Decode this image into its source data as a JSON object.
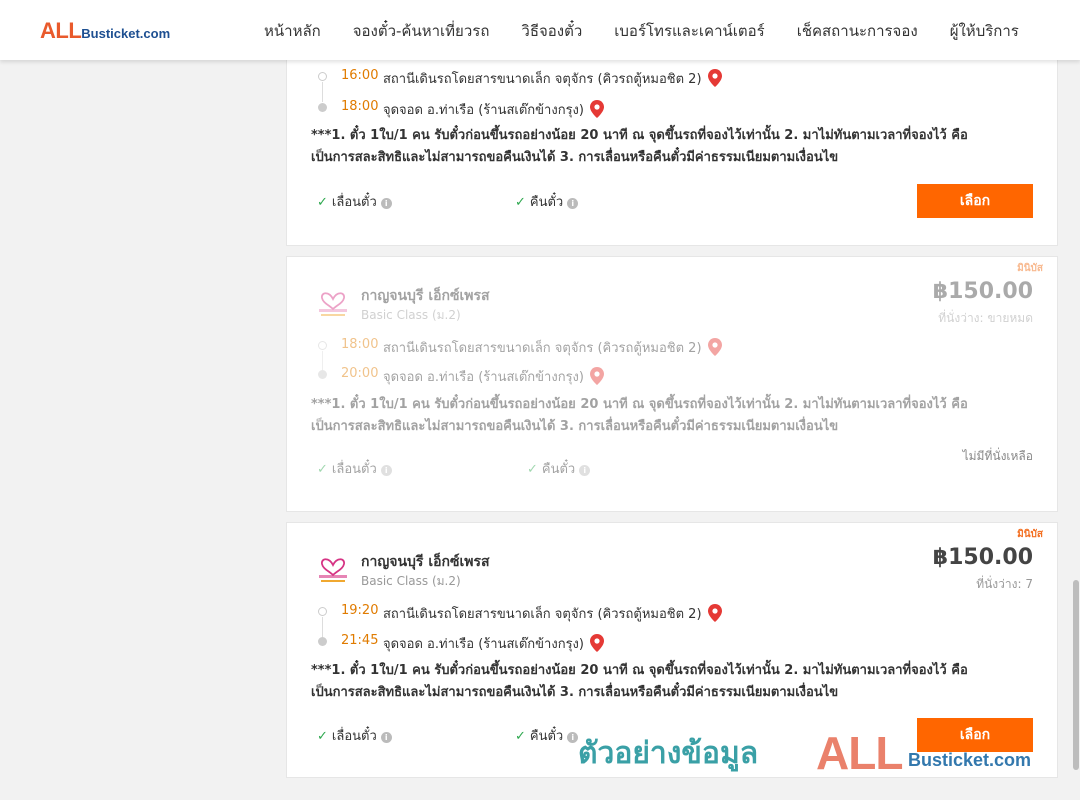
{
  "header": {
    "logo_all": "ALL",
    "logo_rest": "Busticket.com",
    "nav": [
      "หน้าหลัก",
      "จองตั๋ว-ค้นหาเที่ยวรถ",
      "วิธีจองตั๋ว",
      "เบอร์โทรและเคาน์เตอร์",
      "เช็คสถานะการจอง",
      "ผู้ให้บริการ"
    ]
  },
  "cards": [
    {
      "depart_time": "16:00",
      "depart_place": "สถานีเดินรถโดยสารขนาดเล็ก จตุจักร (คิวรถตู้หมอชิต 2)",
      "arrive_time": "18:00",
      "arrive_place": "จุดจอด อ.ท่าเรือ (ร้านสเต๊กข้างกรุง)",
      "note_line1": "***1. ตั๋ว 1ใบ/1 คน รับตั๋วก่อนขึ้นรถอย่างน้อย 20 นาที ณ จุดขึ้นรถที่จองไว้เท่านั้น 2. มาไม่ทันตามเวลาที่จองไว้ คือ",
      "note_line2": "เป็นการสละสิทธิและไม่สามารถขอคืนเงินได้ 3. การเลื่อนหรือคืนตั๋วมีค่าธรรมเนียมตามเงื่อนไข",
      "feature1": "เลื่อนตั๋ว",
      "feature2": "คืนตั๋ว",
      "button": "เลือก"
    },
    {
      "badge": "มินิบัส",
      "operator": "กาญจนบุรี เอ็กซ์เพรส",
      "class": "Basic Class (ม.2)",
      "price": "฿150.00",
      "seats": "ที่นั่งว่าง: ขายหมด",
      "depart_time": "18:00",
      "depart_place": "สถานีเดินรถโดยสารขนาดเล็ก จตุจักร (คิวรถตู้หมอชิต 2)",
      "arrive_time": "20:00",
      "arrive_place": "จุดจอด อ.ท่าเรือ (ร้านสเต๊กข้างกรุง)",
      "note_line1": "***1. ตั๋ว 1ใบ/1 คน รับตั๋วก่อนขึ้นรถอย่างน้อย 20 นาที ณ จุดขึ้นรถที่จองไว้เท่านั้น 2. มาไม่ทันตามเวลาที่จองไว้ คือ",
      "note_line2": "เป็นการสละสิทธิและไม่สามารถขอคืนเงินได้ 3. การเลื่อนหรือคืนตั๋วมีค่าธรรมเนียมตามเงื่อนไข",
      "feature1": "เลื่อนตั๋ว",
      "feature2": "คืนตั๋ว",
      "no_seats": "ไม่มีที่นั่งเหลือ"
    },
    {
      "badge": "มินิบัส",
      "operator": "กาญจนบุรี เอ็กซ์เพรส",
      "class": "Basic Class (ม.2)",
      "price": "฿150.00",
      "seats": "ที่นั่งว่าง: 7",
      "depart_time": "19:20",
      "depart_place": "สถานีเดินรถโดยสารขนาดเล็ก จตุจักร (คิวรถตู้หมอชิต 2)",
      "arrive_time": "21:45",
      "arrive_place": "จุดจอด อ.ท่าเรือ (ร้านสเต๊กข้างกรุง)",
      "note_line1": "***1. ตั๋ว 1ใบ/1 คน รับตั๋วก่อนขึ้นรถอย่างน้อย 20 นาที ณ จุดขึ้นรถที่จองไว้เท่านั้น 2. มาไม่ทันตามเวลาที่จองไว้ คือ",
      "note_line2": "เป็นการสละสิทธิและไม่สามารถขอคืนเงินได้ 3. การเลื่อนหรือคืนตั๋วมีค่าธรรมเนียมตามเงื่อนไข",
      "feature1": "เลื่อนตั๋ว",
      "feature2": "คืนตั๋ว",
      "button": "เลือก"
    }
  ],
  "watermark": {
    "text": "ตัวอย่างข้อมูล",
    "all": "ALL",
    "rest": "Busticket.com"
  },
  "icons": {
    "pin": "map-pin-icon",
    "check": "check-icon",
    "info": "info-icon",
    "operator_logo": "kanchanaburi-express-logo"
  },
  "colors": {
    "accent": "#ff6600",
    "time": "#e07b00",
    "pin": "#e53935",
    "check": "#2ea84f"
  }
}
